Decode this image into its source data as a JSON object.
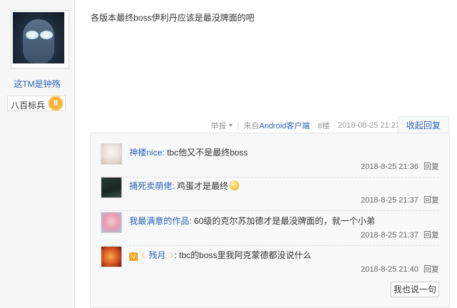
{
  "author": {
    "name": "这TM是钟殇",
    "level_title": "八百标兵",
    "level_number": "8"
  },
  "post": {
    "content": "各版本最终boss伊利丹应该是最没牌面的吧",
    "tail": {
      "report": "举报",
      "from_prefix": "来自",
      "client": "Android客户端",
      "floor": "8楼",
      "time": "2018-08-25 21:21"
    },
    "collapse_reply": "收起回复"
  },
  "replies": [
    {
      "user": "神楼nice:",
      "text": " tbc他又不是最终boss",
      "time": "2018-8-25 21:36",
      "reply_label": "回复"
    },
    {
      "user": "捅死卖萌佬:",
      "text": " 鸡蛋才是最终",
      "emoji": "egg-face",
      "time": "2018-8-25 21:37",
      "reply_label": "回复"
    },
    {
      "user": "我最满意的作品:",
      "text": " 60级的克尔苏加德才是最没牌面的，就一个小弟",
      "time": "2018-8-25 21:37",
      "reply_label": "回复"
    },
    {
      "badge_icon": "V",
      "user": "残月",
      "text": "tbc的boss里我阿克蒙德都没说什么",
      "time": "2018-8-25 21:40",
      "reply_label": "回复"
    }
  ],
  "say_button": "我也说一句"
}
